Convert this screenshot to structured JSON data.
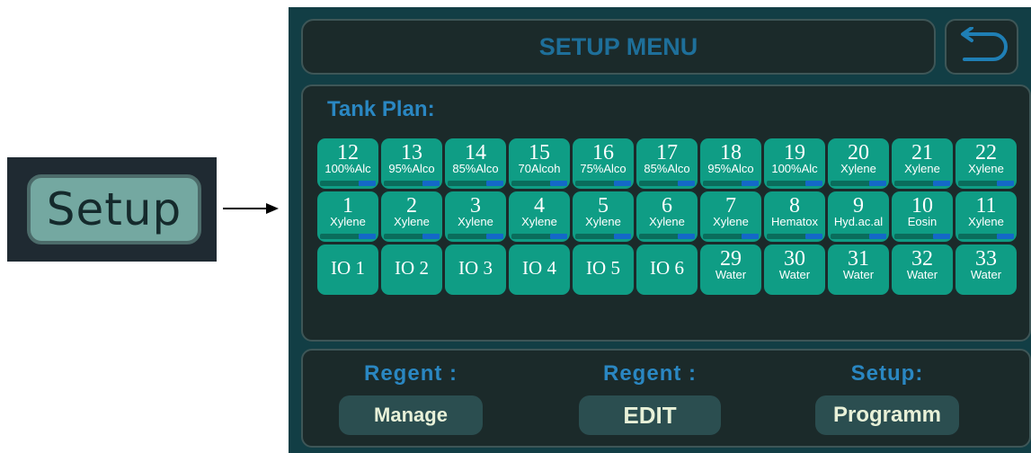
{
  "inset": {
    "button_label": "Setup"
  },
  "header": {
    "title": "SETUP MENU"
  },
  "tank_plan": {
    "title": "Tank Plan:",
    "rows": [
      [
        {
          "num": "12",
          "name": "100%Alc"
        },
        {
          "num": "13",
          "name": "95%Alco"
        },
        {
          "num": "14",
          "name": "85%Alco"
        },
        {
          "num": "15",
          "name": "70Alcoh"
        },
        {
          "num": "16",
          "name": "75%Alco"
        },
        {
          "num": "17",
          "name": "85%Alco"
        },
        {
          "num": "18",
          "name": "95%Alco"
        },
        {
          "num": "19",
          "name": "100%Alc"
        },
        {
          "num": "20",
          "name": "Xylene"
        },
        {
          "num": "21",
          "name": "Xylene"
        },
        {
          "num": "22",
          "name": "Xylene"
        }
      ],
      [
        {
          "num": "1",
          "name": "Xylene"
        },
        {
          "num": "2",
          "name": "Xylene"
        },
        {
          "num": "3",
          "name": "Xylene"
        },
        {
          "num": "4",
          "name": "Xylene"
        },
        {
          "num": "5",
          "name": "Xylene"
        },
        {
          "num": "6",
          "name": "Xylene"
        },
        {
          "num": "7",
          "name": "Xylene"
        },
        {
          "num": "8",
          "name": "Hematox"
        },
        {
          "num": "9",
          "name": "Hyd.ac.al"
        },
        {
          "num": "10",
          "name": "Eosin"
        },
        {
          "num": "11",
          "name": "Xylene"
        }
      ],
      [
        {
          "io": "IO 1"
        },
        {
          "io": "IO 2"
        },
        {
          "io": "IO 3"
        },
        {
          "io": "IO 4"
        },
        {
          "io": "IO 5"
        },
        {
          "io": "IO 6"
        },
        {
          "num": "29",
          "name": "Water"
        },
        {
          "num": "30",
          "name": "Water"
        },
        {
          "num": "31",
          "name": "Water"
        },
        {
          "num": "32",
          "name": "Water"
        },
        {
          "num": "33",
          "name": "Water"
        }
      ]
    ]
  },
  "bottom": {
    "items": [
      {
        "label": "Regent :",
        "button": "Manage"
      },
      {
        "label": "Regent :",
        "button": "EDIT"
      },
      {
        "label": "Setup:",
        "button": "Programm"
      }
    ]
  },
  "colors": {
    "accent_text": "#2a87c2",
    "tank_fill": "#0f9d85",
    "level_bar": "#1468c8",
    "panel": "#1b2a2a",
    "screen_bg": "#123e45"
  },
  "icons": {
    "back": "return-arrow-icon",
    "pointer": "arrow-right-icon"
  }
}
